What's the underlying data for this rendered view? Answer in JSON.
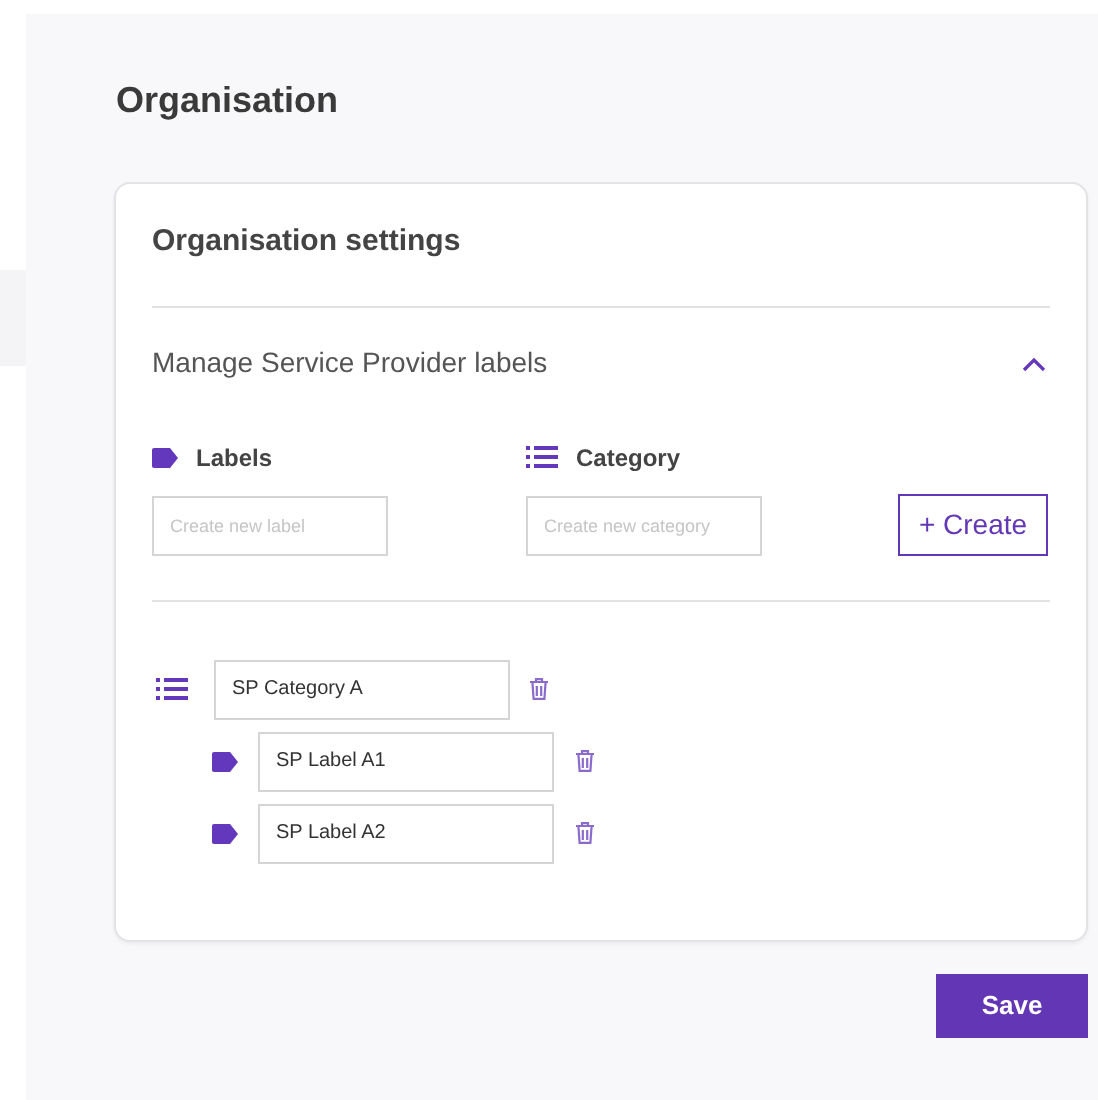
{
  "page_title": "Organisation",
  "card": {
    "title": "Organisation settings",
    "section": {
      "title": "Manage Service Provider labels",
      "expanded": true,
      "label_field": {
        "heading": "Labels",
        "placeholder": "Create new label"
      },
      "category_field": {
        "heading": "Category",
        "placeholder": "Create new category"
      },
      "create_button": "+ Create",
      "categories": [
        {
          "value": "SP Category A",
          "children": [
            {
              "value": "SP Label A1"
            },
            {
              "value": "SP Label A2"
            }
          ]
        }
      ]
    }
  },
  "save_button": "Save"
}
